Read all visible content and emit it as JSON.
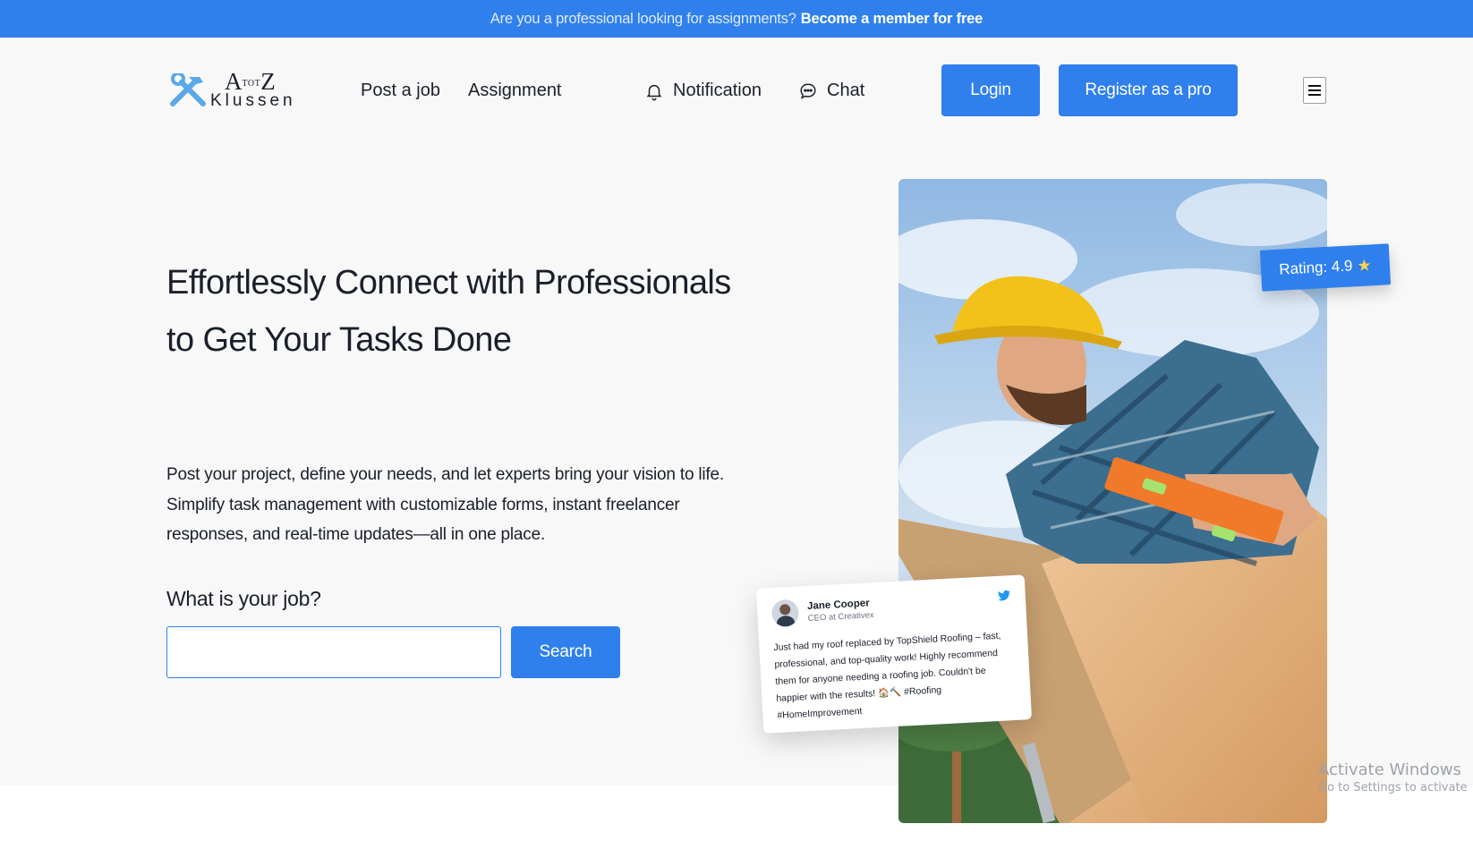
{
  "topbar": {
    "text": "Are you a professional looking for assignments?",
    "cta": "Become a member for free"
  },
  "logo": {
    "letter_a": "A",
    "tot": "TOT",
    "letter_z": "Z",
    "word": "Klussen",
    "icon": "hammer-wrench-icon"
  },
  "nav": {
    "post_job": "Post a job",
    "assignment": "Assignment",
    "notification": "Notification",
    "chat": "Chat",
    "login": "Login",
    "register": "Register as a pro"
  },
  "hero": {
    "title": "Effortlessly Connect with Professionals to Get Your Tasks Done",
    "description": "Post your project, define your needs, and let experts bring your vision to life. Simplify task management with customizable forms, instant freelancer responses, and real-time updates—all in one place.",
    "job_label": "What is your job?",
    "job_input_value": "",
    "search_button": "Search"
  },
  "rating": {
    "text": "Rating: 4.9",
    "star": "★"
  },
  "testimonial": {
    "name": "Jane Cooper",
    "role": "CEO at Creativex",
    "text": "Just had my roof replaced by TopShield Roofing – fast, professional, and top-quality work! Highly recommend them for anyone needing a roofing job. Couldn't be happier with the results! 🏠🔨 #Roofing #HomeImprovement"
  },
  "watermark": {
    "line1": "Activate Windows",
    "line2": "Go to Settings to activate"
  },
  "colors": {
    "primary": "#2f80ed",
    "background": "#f8f8f8",
    "text": "#1a1f2b",
    "star": "#ffd54a"
  }
}
